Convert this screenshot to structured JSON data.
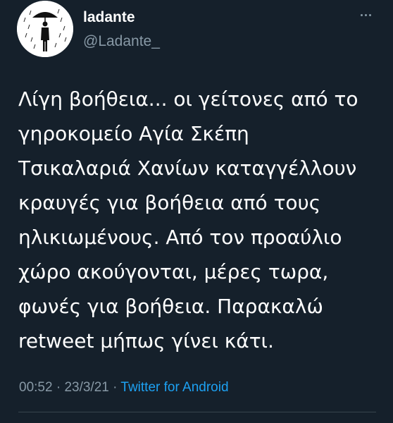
{
  "author": {
    "display_name": "ladante",
    "handle": "@Ladante_",
    "avatar_icon": "man-with-umbrella-in-rain-icon"
  },
  "tweet": {
    "text": "Λίγη βοήθεια... οι γείτονες από το\nγηροκομείο Αγία Σκέπη\nΤσικαλαριά Χανίων καταγγέλλουν\nκραυγές για βοήθεια από τους\nηλικιωμένους. Από τον προαύλιο\nχώρο ακούγονται, μέρες τωρα,\nφωνές για βοήθεια. Παρακαλώ\nretweet μήπως γίνει κάτι.",
    "time": "00:52",
    "date": "23/3/21",
    "source": "Twitter for Android"
  },
  "colors": {
    "background": "#15202b",
    "text_primary": "#ffffff",
    "text_secondary": "#8899a6",
    "link": "#1da1f2",
    "divider": "#38444d"
  },
  "icons": {
    "more": "more-horizontal-icon"
  }
}
